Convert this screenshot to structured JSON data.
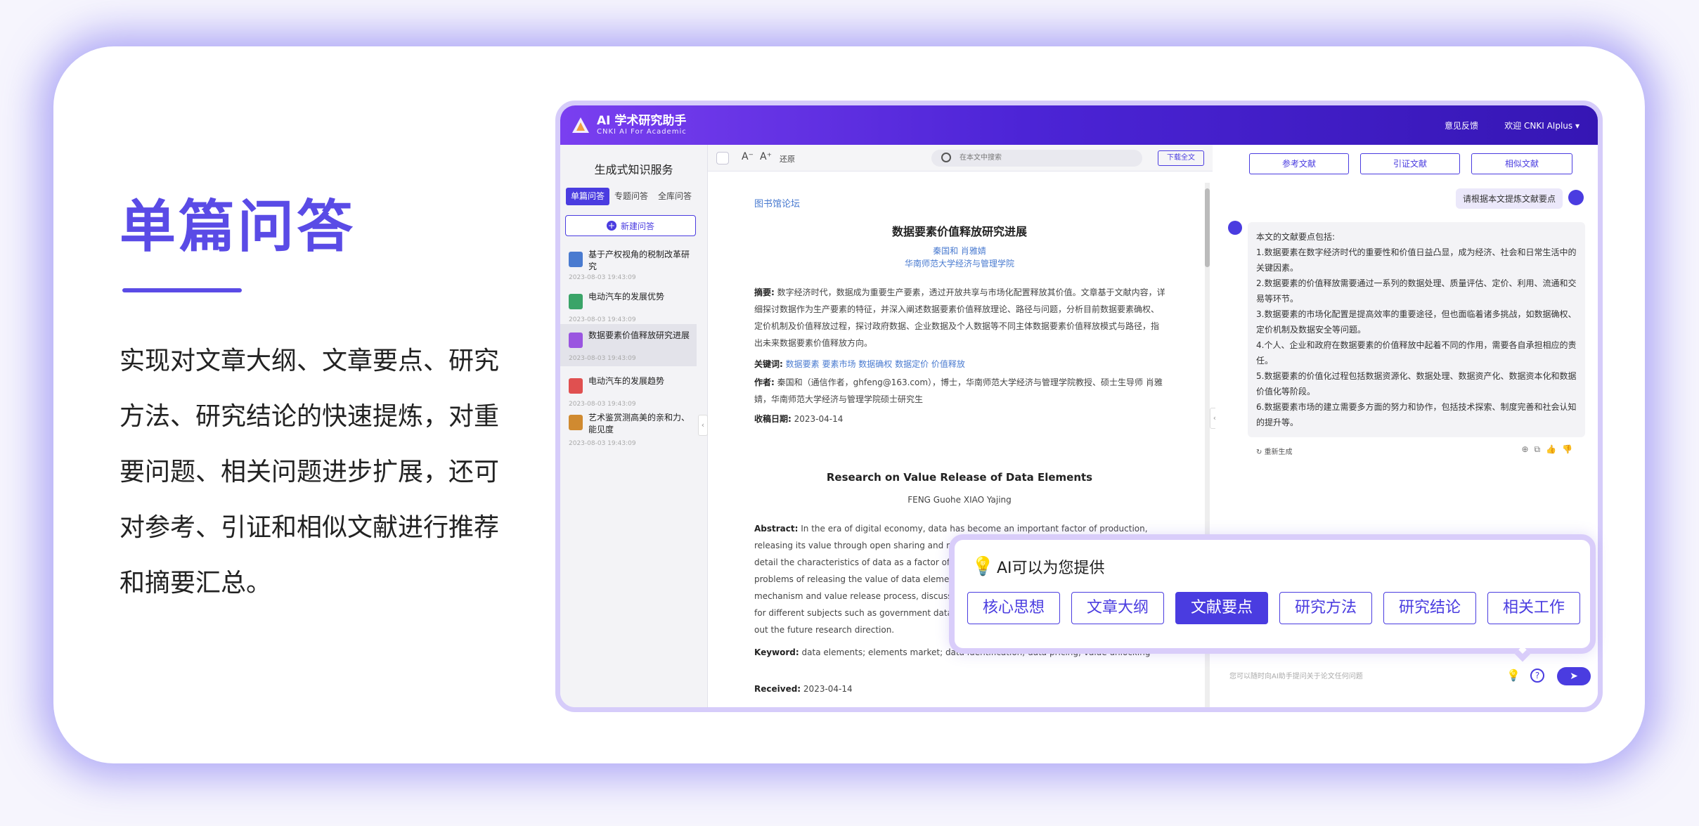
{
  "hero": {
    "title": "单篇问答",
    "desc": "实现对文章大纲、文章要点、研究方法、研究结论的快速提炼，对重要问题、相关问题进步扩展，还可对参考、引证和相似文献进行推荐和摘要汇总。"
  },
  "header": {
    "title": "AI 学术研究助手",
    "subtitle": "CNKI AI For Academic",
    "feedback": "意见反馈",
    "welcome": "欢迎 CNKI AIplus ▾"
  },
  "sidebar": {
    "heading": "生成式知识服务",
    "tabs": [
      "单篇问答",
      "专题问答",
      "全库问答"
    ],
    "new_button": "新建问答",
    "items": [
      {
        "title": "基于产权视角的税制改革研究",
        "date": "2023-08-03  19:43:09",
        "icon": "doc-blue"
      },
      {
        "title": "电动汽车的发展优势",
        "date": "2023-08-03  19:43:09",
        "icon": "doc-green"
      },
      {
        "title": "数据要素价值释放研究进展",
        "date": "2023-08-03  19:43:09",
        "icon": "doc-purple"
      },
      {
        "title": "电动汽车的发展趋势",
        "date": "2023-08-03  19:43:09",
        "icon": "doc-red"
      },
      {
        "title": "艺术鉴赏测高美的亲和力、能见度",
        "date": "2023-08-03  19:43:09",
        "icon": "doc-orange"
      }
    ]
  },
  "toolbar": {
    "restore": "还原",
    "search_placeholder": "在本文中搜索",
    "download": "下载全文"
  },
  "paper": {
    "journal": "图书馆论坛",
    "title_cn": "数据要素价值释放研究进展",
    "authors_cn": "秦国和   肖雅婧",
    "affiliation_cn": "华南师范大学经济与管理学院",
    "abstract_label": "摘要:",
    "abstract_cn": "数字经济时代，数据成为重要生产要素，透过开放共享与市场化配置释放其价值。文章基于文献内容，详细探讨数据作为生产要素的特征，并深入阐述数据要素价值释放理论、路径与问题，分析目前数据要素确权、定价机制及价值释放过程，探讨政府数据、企业数据及个人数据等不同主体数据要素价值释放模式与路径，指出未来数据要素价值释放方向。",
    "keywords_label": "关键词:",
    "keywords_cn": "数据要素  要素市场  数据确权  数据定价  价值释放",
    "author_label": "作者:",
    "author_cn": "秦国和（通信作者，ghfeng@163.com），博士，华南师范大学经济与管理学院教授、硕士生导师  肖雅婧，华南师范大学经济与管理学院硕士研究生",
    "received_label": "收稿日期:",
    "received_cn": "2023-04-14",
    "title_en": "Research on Value Release of Data Elements",
    "authors_en": "FENG Guohe      XIAO Yajing",
    "abstract_en_label": "Abstract:",
    "abstract_en": "In the era of digital economy, data has become an important factor of production, releasing its value through open sharing and market-oriented allocation. This paper explores in detail the characteristics of data as a factor of production and elaborates the theory, path, and problems of releasing the value of data elements. It analyzes the current identification, pricing mechanism and value release process, discusses the mode and path of data factor value release for different subjects such as government data, enterprise data and personal data, and points out the future research direction.",
    "keyword_en_label": "Keyword:",
    "keyword_en": "data elements;   elements market;   data identification;   data pricing;   value unlocking",
    "received_en_label": "Received:",
    "received_en": "2023-04-14"
  },
  "chat": {
    "tabs": [
      "参考文献",
      "引证文献",
      "相似文献"
    ],
    "user_question": "请根据本文提炼文献要点",
    "answer": [
      "本文的文献要点包括:",
      "1.数据要素在数字经济时代的重要性和价值日益凸显，成为经济、社会和日常生活中的关键因素。",
      "2.数据要素的价值释放需要通过一系列的数据处理、质量评估、定价、利用、流通和交易等环节。",
      "3.数据要素的市场化配置是提高效率的重要途径，但也面临着诸多挑战，如数据确权、定价机制及数据安全等问题。",
      "4.个人、企业和政府在数据要素的价值释放中起着不同的作用，需要各自承担相应的责任。",
      "5.数据要素的价值化过程包括数据资源化、数据处理、数据资产化、数据资本化和数据价值化等阶段。",
      "6.数据要素市场的建立需要多方面的努力和协作，包括技术探索、制度完善和社会认知的提升等。"
    ],
    "regenerate": "重新生成",
    "input_placeholder": "您可以随时向AI助手提问关于论文任何问题"
  },
  "popup": {
    "heading": "AI可以为您提供",
    "chips": [
      "核心思想",
      "文章大纲",
      "文献要点",
      "研究方法",
      "研究结论",
      "相关工作"
    ],
    "active": "文献要点"
  }
}
